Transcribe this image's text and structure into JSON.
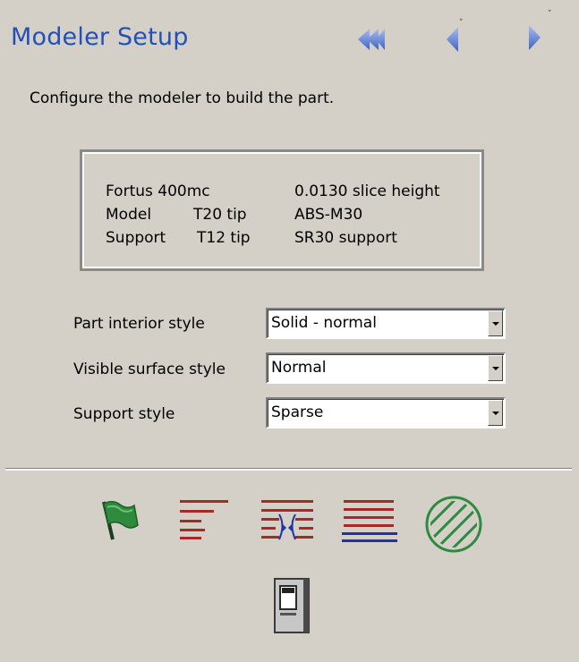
{
  "header": {
    "title": "Modeler Setup",
    "nav_buttons": [
      "rewind-to-start-icon",
      "previous-icon",
      "next-icon"
    ]
  },
  "instructions": "Configure the modeler to build the part.",
  "info": {
    "modeler": "Fortus 400mc",
    "slice_height": "0.0130 slice height",
    "model_label": "Model",
    "model_tip": "T20 tip",
    "model_material": "ABS-M30",
    "support_label": "Support",
    "support_tip": "T12 tip",
    "support_material": "SR30 support"
  },
  "form": {
    "part_interior": {
      "label": "Part interior style",
      "value": "Solid - normal"
    },
    "visible_surface": {
      "label": "Visible surface style",
      "value": "Normal"
    },
    "support_style": {
      "label": "Support style",
      "value": "Sparse"
    }
  },
  "toolbar": {
    "tools": [
      "green-flag-icon",
      "lines-icon",
      "converge-lines-icon",
      "blue-underline-lines-icon",
      "hatched-circle-icon",
      "modeler-machine-icon"
    ]
  },
  "colors": {
    "title": "#2350b8",
    "nav_arrow": "#5b7fd0",
    "tool_red": "#a52a2a",
    "tool_blue": "#2233aa",
    "tool_green": "#2e8b3e",
    "background": "#d4d0c8"
  }
}
